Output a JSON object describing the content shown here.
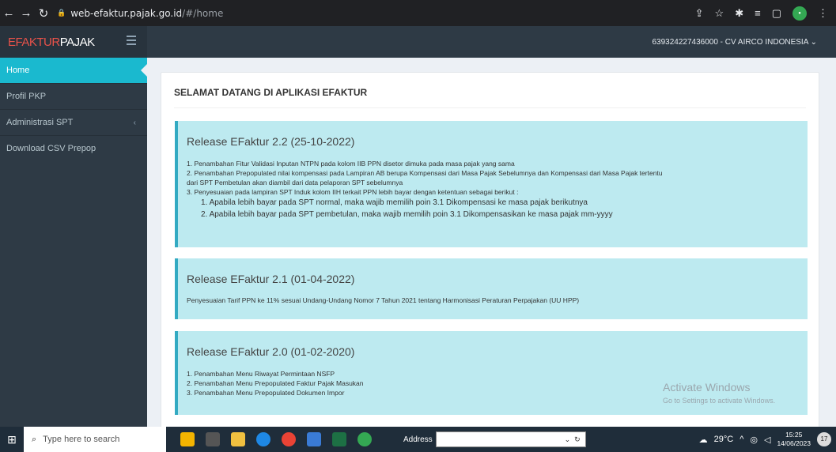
{
  "browser": {
    "url_host": "web-efaktur.pajak.go.id",
    "url_path": "/#/home",
    "icons": [
      "back-icon",
      "forward-icon",
      "reload-icon",
      "lock-icon",
      "share-icon",
      "star-icon",
      "extensions-icon",
      "reading-list-icon",
      "window-icon",
      "profile-icon",
      "menu-icon"
    ]
  },
  "header": {
    "logo_part1": "EFAKTUR",
    "logo_part2": "PAJAK",
    "user": "639324227436000 - CV AIRCO INDONESIA"
  },
  "sidebar": {
    "items": [
      {
        "label": "Home"
      },
      {
        "label": "Profil PKP"
      },
      {
        "label": "Administrasi SPT"
      },
      {
        "label": "Download CSV Prepop"
      }
    ]
  },
  "main": {
    "title": "SELAMAT DATANG DI APLIKASI EFAKTUR",
    "releases": [
      {
        "title": "Release EFaktur 2.2 (25-10-2022)",
        "lines": [
          "1. Penambahan Fitur Validasi Inputan NTPN pada kolom IIB PPN disetor dimuka pada masa pajak yang sama",
          "2. Penambahan Prepopulated nilai kompensasi pada Lampiran AB berupa Kompensasi dari Masa Pajak Sebelumnya dan Kompensasi dari Masa Pajak tertentu",
          "dari SPT Pembetulan akan diambil dari data pelaporan SPT sebelumnya",
          "3. Penyesuaian pada lampiran SPT Induk kolom IIH terkait PPN lebih bayar dengan ketentuan sebagai berikut :"
        ],
        "sub": [
          "1. Apabila lebih bayar pada SPT normal, maka wajib memilih poin 3.1 Dikompensasi ke masa pajak berikutnya",
          "2. Apabila lebih bayar pada SPT pembetulan, maka wajib memilih poin 3.1 Dikompensasikan ke masa pajak mm-yyyy"
        ]
      },
      {
        "title": "Release EFaktur 2.1 (01-04-2022)",
        "lines": [
          "Penyesuaian Tarif PPN ke 11% sesuai Undang-Undang Nomor 7 Tahun 2021 tentang Harmonisasi Peraturan Perpajakan (UU HPP)"
        ]
      },
      {
        "title": "Release EFaktur 2.0 (01-02-2020)",
        "lines": [
          "1. Penambahan Menu Riwayat Permintaan NSFP",
          "2. Penambahan Menu Prepopulated Faktur Pajak Masukan",
          "3. Penambahan Menu Prepopulated Dokumen Impor"
        ]
      }
    ]
  },
  "watermark": {
    "line1": "Activate Windows",
    "line2": "Go to Settings to activate Windows."
  },
  "taskbar": {
    "search_placeholder": "Type here to search",
    "address_label": "Address",
    "temperature": "29°C",
    "time": "15:25",
    "date": "14/06/2023",
    "notifications": "17"
  }
}
